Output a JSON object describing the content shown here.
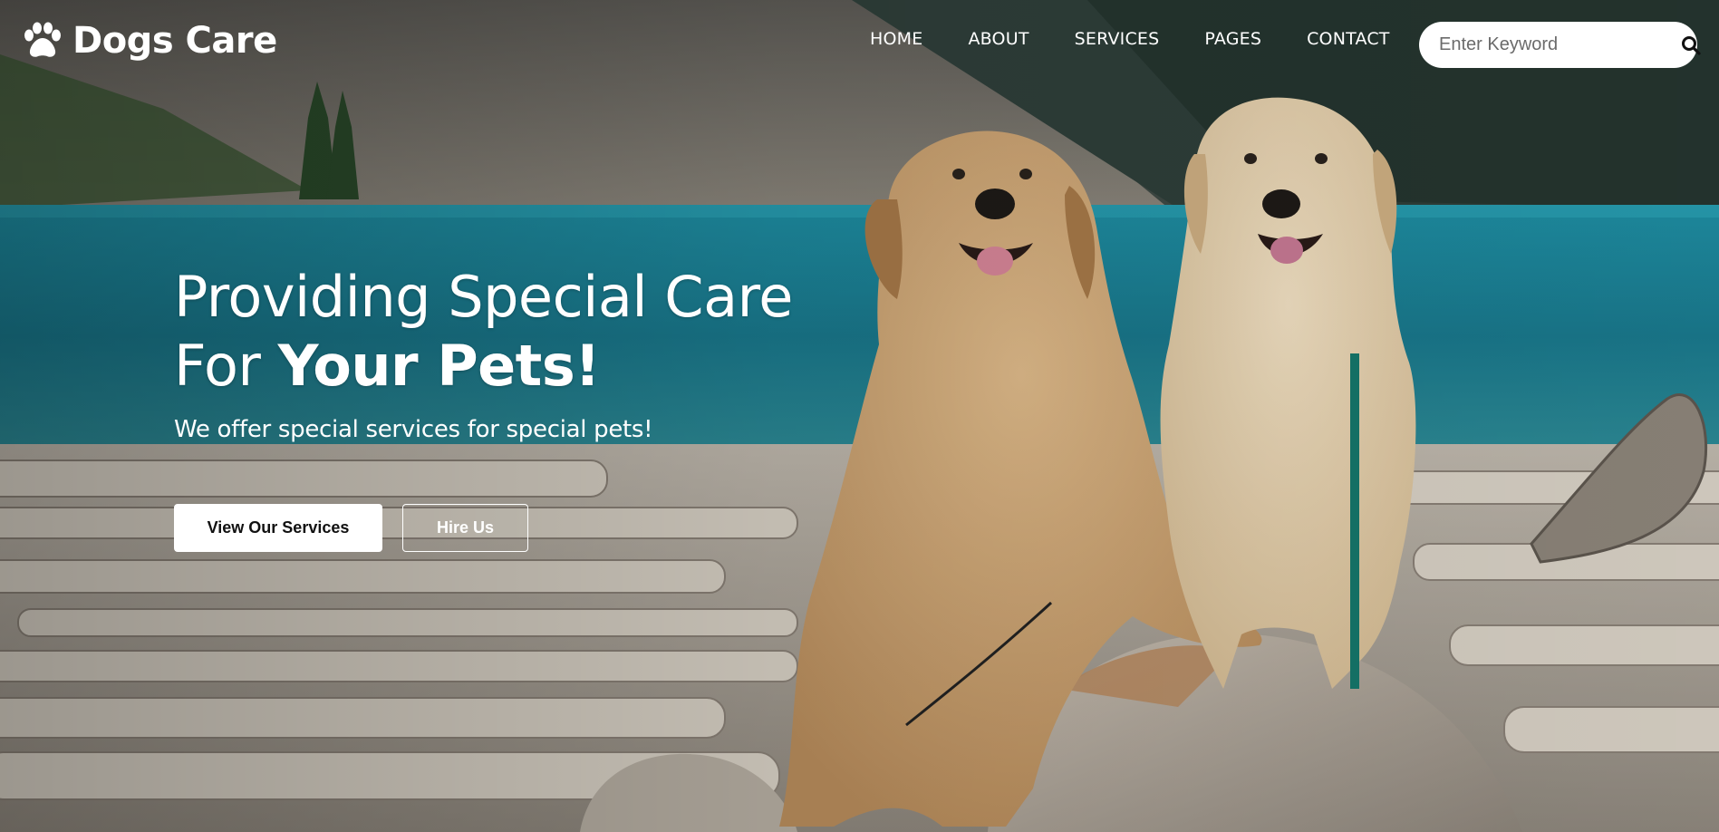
{
  "brand": {
    "logo_text": "Dogs Care",
    "logo_icon": "paw-icon"
  },
  "nav": {
    "items": [
      {
        "label": "HOME"
      },
      {
        "label": "ABOUT"
      },
      {
        "label": "SERVICES"
      },
      {
        "label": "PAGES"
      },
      {
        "label": "CONTACT"
      }
    ]
  },
  "search": {
    "placeholder": "Enter Keyword",
    "value": "",
    "icon": "search-icon"
  },
  "hero": {
    "headline_line1": "Providing Special Care",
    "headline_line2_prefix": "For",
    "headline_line2_bold": "Your Pets!",
    "subtitle": "We offer special services for special pets!",
    "primary_button": "View Our Services",
    "secondary_button": "Hire Us",
    "background_image": "two golden retrievers sitting on logs and rocks by a turquoise mountain lake"
  },
  "colors": {
    "text": "#ffffff",
    "primary_button_bg": "#ffffff",
    "primary_button_text": "#111111",
    "lake": "#1f8fa3",
    "mountain": "#6f6a61"
  }
}
